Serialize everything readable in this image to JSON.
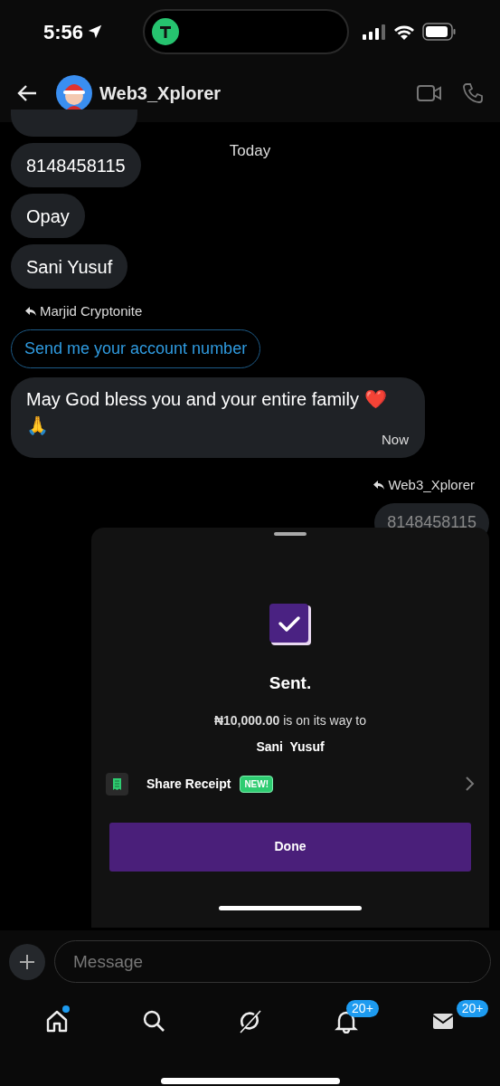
{
  "status_bar": {
    "time": "5:56"
  },
  "header": {
    "title": "Web3_Xplorer"
  },
  "date_divider": "Today",
  "messages": [
    {
      "kind": "bubble",
      "outgoing": false,
      "text": "8148458115"
    },
    {
      "kind": "bubble",
      "outgoing": false,
      "text": "Opay"
    },
    {
      "kind": "bubble",
      "outgoing": false,
      "text": "Sani Yusuf"
    },
    {
      "kind": "reply_to",
      "outgoing": false,
      "text": "Marjid Cryptonite"
    },
    {
      "kind": "quoted",
      "outgoing": false,
      "text": "Send me your account number"
    },
    {
      "kind": "bubble",
      "outgoing": false,
      "text": "May God bless you and your entire family ❤️ 🙏",
      "time": "Now"
    },
    {
      "kind": "reply_to",
      "outgoing": true,
      "text": "Web3_Xplorer"
    },
    {
      "kind": "bubble",
      "outgoing": true,
      "text": "8148458115"
    }
  ],
  "sheet": {
    "title": "Sent.",
    "amount_line": "**₦10,000.00** is on its way to",
    "recipient": "Sani  Yusuf",
    "share": {
      "label": "Share Receipt",
      "badge": "NEW!"
    },
    "done": "Done"
  },
  "composer": {
    "placeholder": "Message"
  },
  "nav": [
    {
      "kind": "home",
      "dot": true
    },
    {
      "kind": "search"
    },
    {
      "kind": "grok"
    },
    {
      "kind": "bell",
      "badge": "20+"
    },
    {
      "kind": "mail",
      "badge": "20+"
    }
  ]
}
